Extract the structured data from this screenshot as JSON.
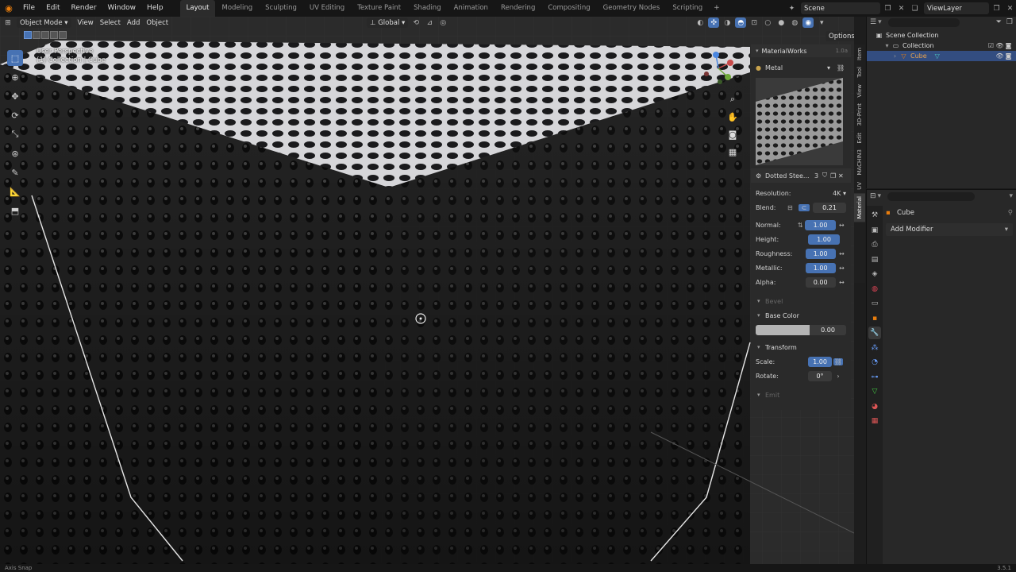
{
  "menu": [
    "File",
    "Edit",
    "Render",
    "Window",
    "Help"
  ],
  "workspaces": [
    "Layout",
    "Modeling",
    "Sculpting",
    "UV Editing",
    "Texture Paint",
    "Shading",
    "Animation",
    "Rendering",
    "Compositing",
    "Geometry Nodes",
    "Scripting"
  ],
  "active_workspace": "Layout",
  "scene_name": "Scene",
  "view_layer": "ViewLayer",
  "viewport": {
    "mode": "Object Mode",
    "menus": [
      "View",
      "Select",
      "Add",
      "Object"
    ],
    "transform_orientation": "Global",
    "options_label": "Options",
    "perspective_label": "User Perspective",
    "collection_label": "(1) Collection | Cube"
  },
  "materialworks": {
    "panel_title": "MaterialWorks",
    "version": "1.0a",
    "material_name": "Metal",
    "texture_name": "Dotted Stee...",
    "texture_users": "3",
    "resolution_label": "Resolution:",
    "resolution": "4K",
    "blend_label": "Blend:",
    "blend": "0.21",
    "params": [
      {
        "label": "Normal:",
        "value": "1.00"
      },
      {
        "label": "Height:",
        "value": "1.00"
      },
      {
        "label": "Roughness:",
        "value": "1.00"
      },
      {
        "label": "Metallic:",
        "value": "1.00"
      },
      {
        "label": "Alpha:",
        "value": "0.00"
      }
    ],
    "bevel_label": "Bevel",
    "base_color_label": "Base Color",
    "base_color_value": "0.00",
    "transform_label": "Transform",
    "scale_label": "Scale:",
    "scale": "1.00",
    "rotate_label": "Rotate:",
    "rotate": "0°",
    "emit_label": "Emit"
  },
  "side_tabs": [
    "Item",
    "Tool",
    "View",
    "3D-Print",
    "Edit",
    "MACHIN3",
    "UV",
    "Material"
  ],
  "active_side_tab": "Material",
  "outliner": {
    "rows": [
      {
        "label": "Scene Collection"
      },
      {
        "label": "Collection"
      },
      {
        "label": "Cube"
      }
    ]
  },
  "properties": {
    "object_name": "Cube",
    "add_modifier": "Add Modifier"
  },
  "status": {
    "left": "Axis Snap",
    "version": "3.5.1"
  },
  "colors": {
    "accent": "#4772b3",
    "selected_row": "#334d80",
    "orange": "#e87d0d"
  }
}
